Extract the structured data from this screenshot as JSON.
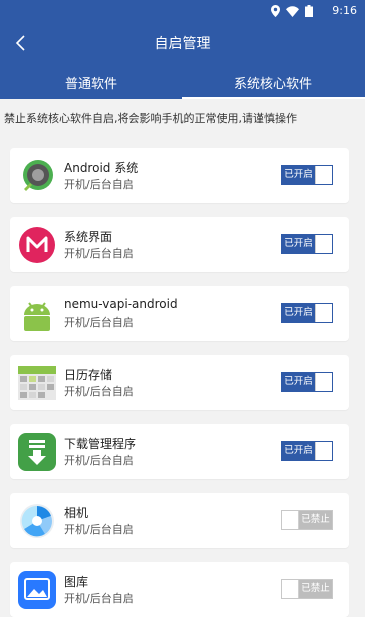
{
  "status_bar": {
    "time": "9:16"
  },
  "app_bar": {
    "title": "自启管理"
  },
  "tabs": [
    {
      "label": "普通软件",
      "active": false
    },
    {
      "label": "系统核心软件",
      "active": true
    }
  ],
  "notice": "禁止系统核心软件自启,将会影响手机的正常使用,请谨慎操作",
  "apps": [
    {
      "name": "Android 系统",
      "subtitle": "开机/后台自启",
      "toggle_label": "已开启",
      "enabled": true
    },
    {
      "name": "系统界面",
      "subtitle": "开机/后台自启",
      "toggle_label": "已开启",
      "enabled": true
    },
    {
      "name": "nemu-vapi-android",
      "subtitle": "开机/后台自启",
      "toggle_label": "已开启",
      "enabled": true
    },
    {
      "name": "日历存储",
      "subtitle": "开机/后台自启",
      "toggle_label": "已开启",
      "enabled": true
    },
    {
      "name": "下载管理程序",
      "subtitle": "开机/后台自启",
      "toggle_label": "已开启",
      "enabled": true
    },
    {
      "name": "相机",
      "subtitle": "开机/后台自启",
      "toggle_label": "已禁止",
      "enabled": false
    },
    {
      "name": "图库",
      "subtitle": "开机/后台自启",
      "toggle_label": "已禁止",
      "enabled": false
    }
  ],
  "colors": {
    "primary": "#2f5aa7",
    "disabled": "#bdbdbd"
  }
}
